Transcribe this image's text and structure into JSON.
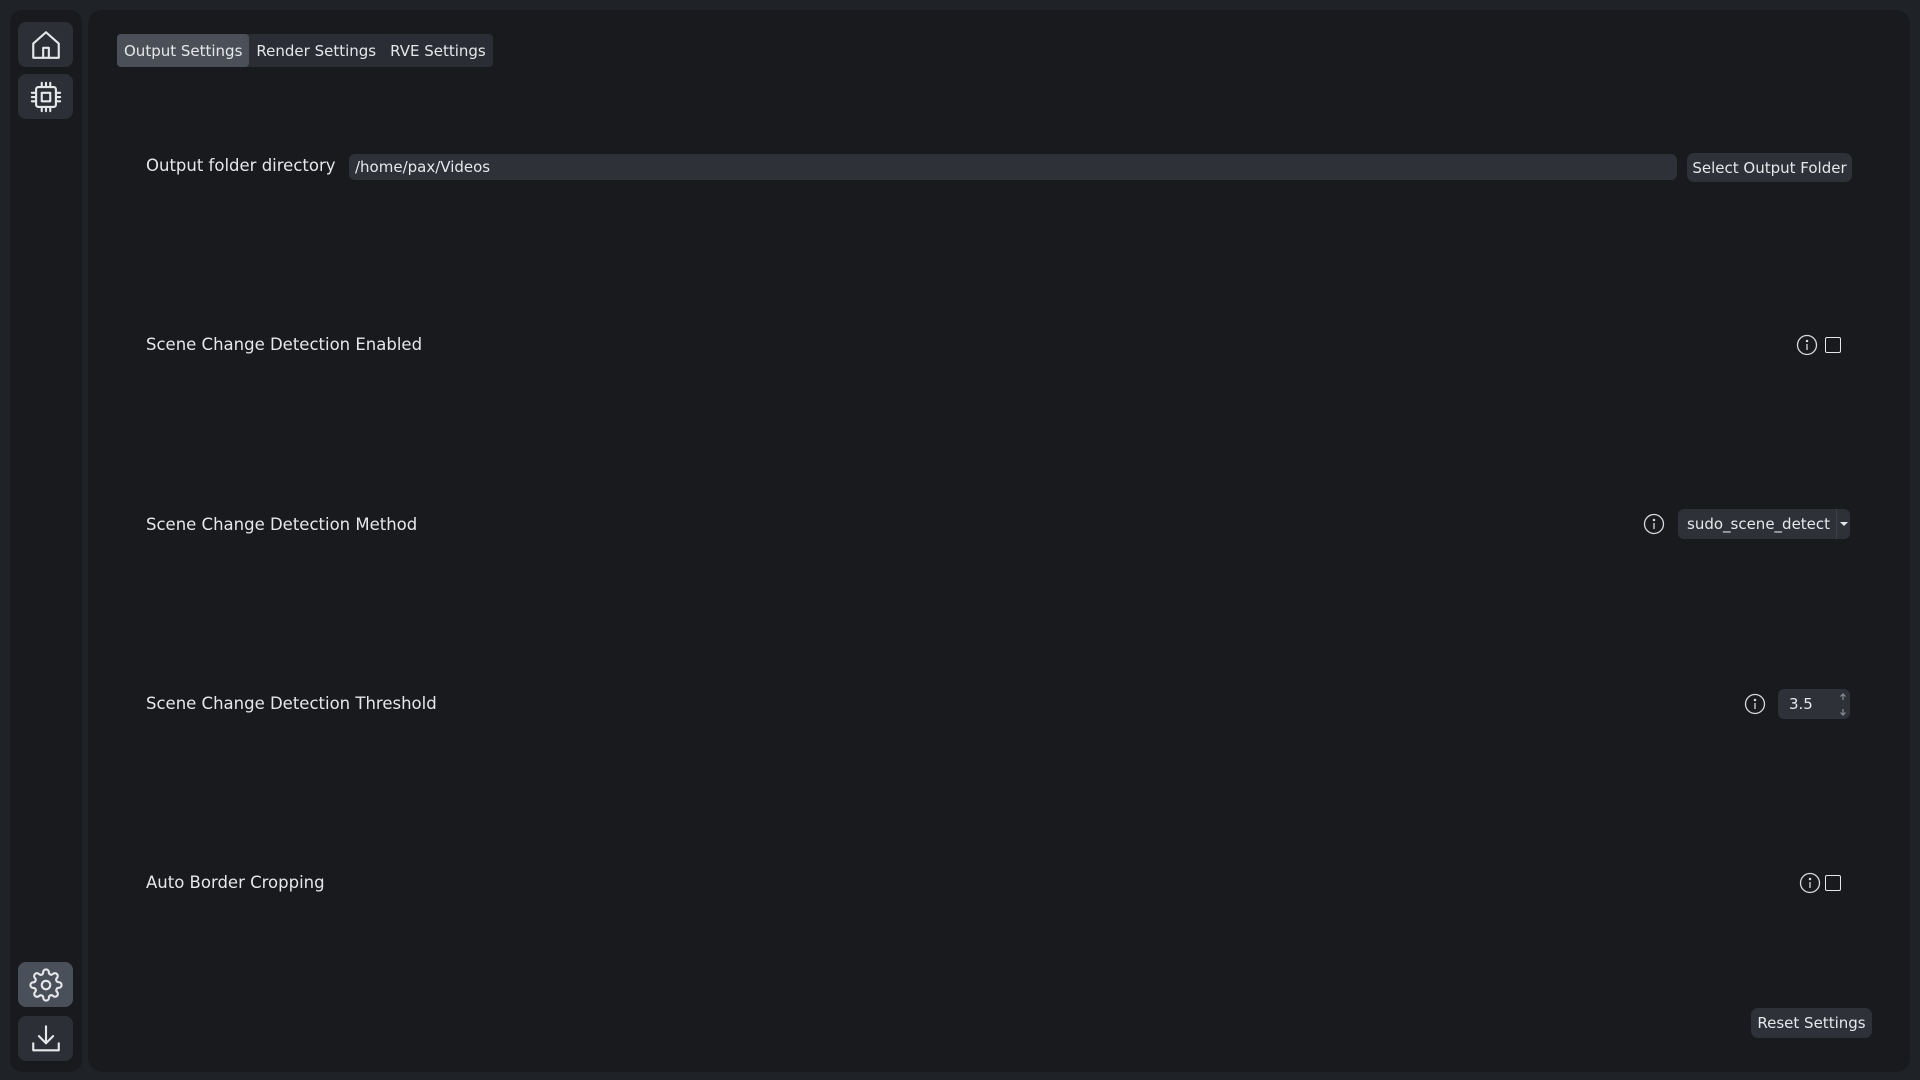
{
  "sidebar": {
    "items": [
      {
        "icon": "home-icon",
        "active": false
      },
      {
        "icon": "chip-icon",
        "active": false
      },
      {
        "icon": "gear-icon",
        "active": true
      },
      {
        "icon": "download-icon",
        "active": false
      }
    ]
  },
  "tabs": [
    {
      "label": "Output Settings",
      "active": true
    },
    {
      "label": "Render Settings",
      "active": false
    },
    {
      "label": "RVE Settings",
      "active": false
    }
  ],
  "output_folder": {
    "label": "Output folder directory",
    "value": "/home/pax/Videos",
    "button_label": "Select Output Folder"
  },
  "scene_change_enabled": {
    "label": "Scene Change Detection Enabled",
    "checked": false
  },
  "scene_change_method": {
    "label": "Scene Change Detection Method",
    "selected": "sudo_scene_detect"
  },
  "scene_change_threshold": {
    "label": "Scene Change Detection Threshold",
    "value": "3.5"
  },
  "auto_border_cropping": {
    "label": "Auto Border Cropping",
    "checked": false
  },
  "reset_button_label": "Reset Settings",
  "colors": {
    "background": "#1f2226",
    "panel": "#181a1e",
    "control": "#2e3238",
    "active_tab": "#4b5058"
  }
}
